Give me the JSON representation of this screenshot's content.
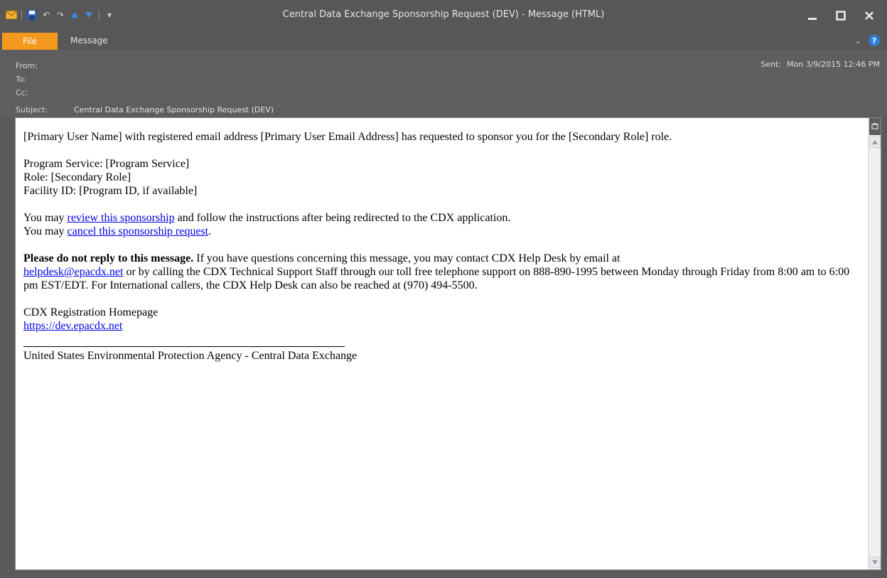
{
  "window": {
    "title": "Central Data Exchange Sponsorship Request (DEV)  -  Message (HTML)"
  },
  "ribbon": {
    "file_tab": "File",
    "message_tab": "Message",
    "help": "?"
  },
  "header": {
    "from_label": "From:",
    "to_label": "To:",
    "cc_label": "Cc:",
    "subject_label": "Subject:",
    "subject_value": "Central Data Exchange Sponsorship Request (DEV)",
    "sent_label": "Sent:",
    "sent_value": "Mon 3/9/2015 12:46 PM"
  },
  "message": {
    "intro": "[Primary User Name] with registered email address [Primary User Email Address] has requested to sponsor you for the [Secondary Role] role.",
    "program_service": "Program Service: [Program Service]",
    "role": "Role: [Secondary Role]",
    "facility_id": "Facility ID: [Program ID, if available]",
    "review_prefix": "You may ",
    "review_link": "review this sponsorship",
    "review_suffix": " and follow the instructions after being redirected to the CDX application.",
    "cancel_prefix": "You may ",
    "cancel_link": "cancel this sponsorship request",
    "cancel_suffix": ".",
    "notice_bold": "Please do not reply to this message.",
    "notice_text": " If you have questions concerning this message, you may contact CDX Help Desk by email at",
    "helpdesk_email": "helpdesk@epacdx.net",
    "notice_text2": " or by calling the CDX Technical Support Staff through our toll free telephone support on 888-890-1995 between Monday through Friday from 8:00 am to 6:00 pm EST/EDT. For International callers, the CDX Help Desk can also be reached at (970) 494-5500.",
    "homepage_label": "CDX Registration Homepage",
    "homepage_link": "https://dev.epacdx.net",
    "footer": "United States Environmental Protection Agency - Central Data Exchange"
  }
}
